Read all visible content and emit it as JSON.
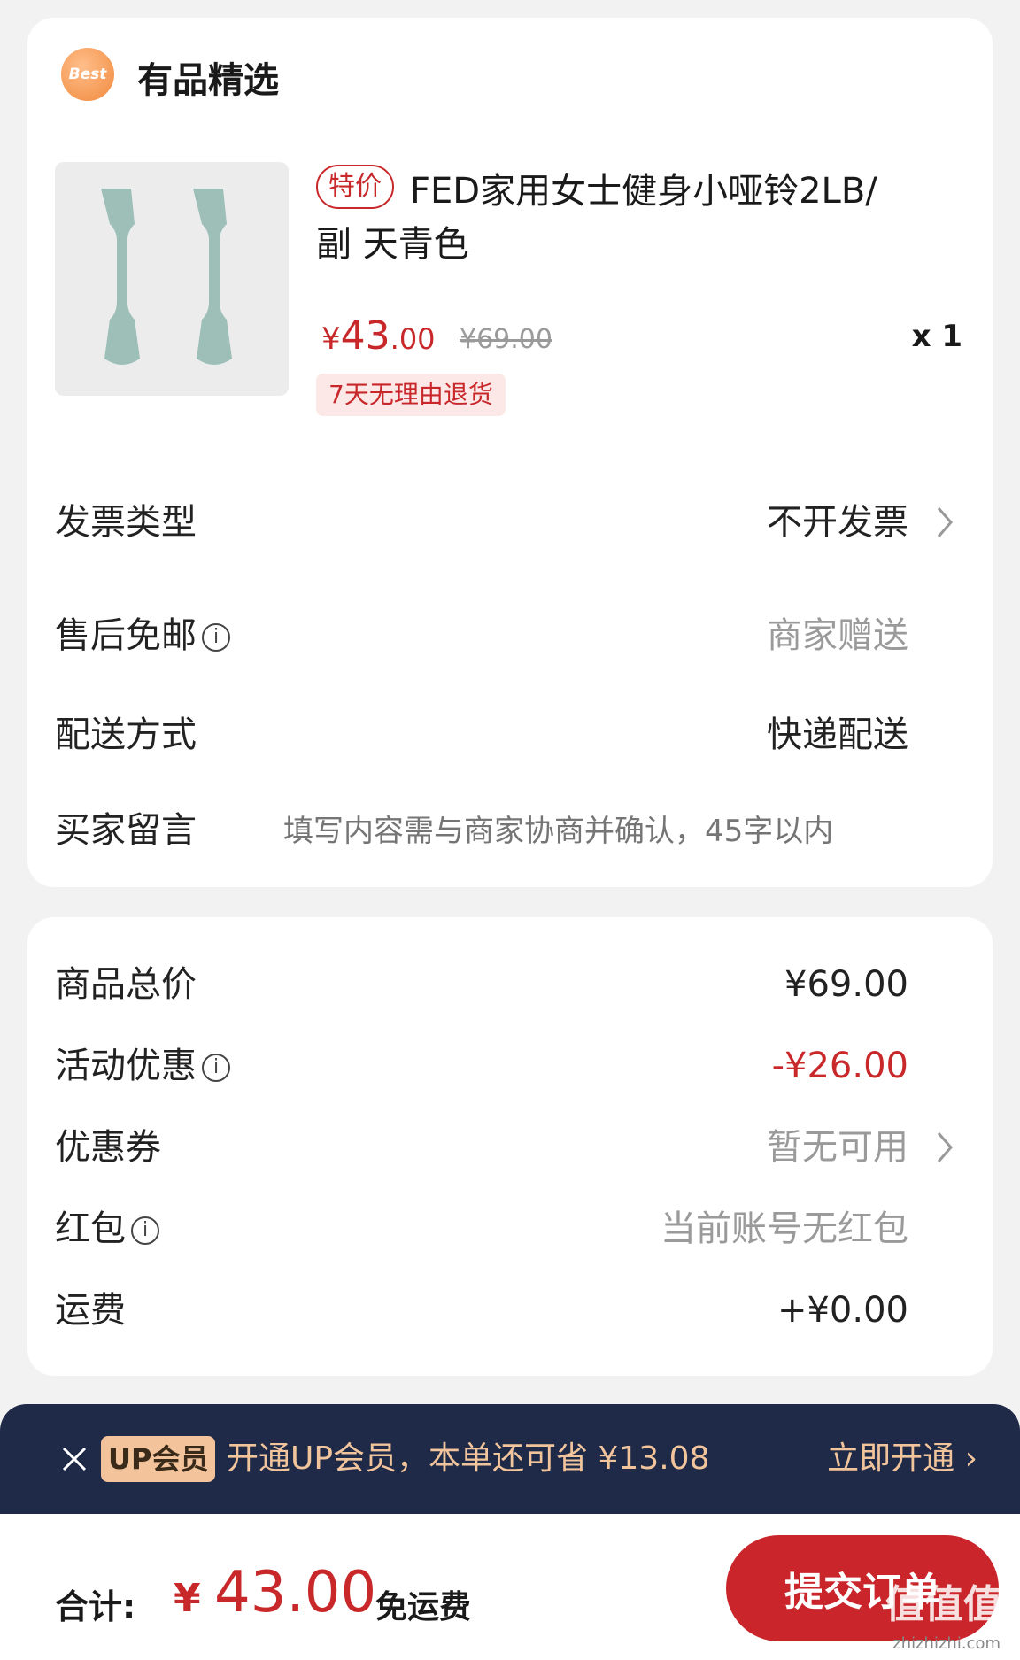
{
  "shop": {
    "badge_text": "Best",
    "title": "有品精选"
  },
  "product": {
    "tag": "特价",
    "name": "FED家用女士健身小哑铃2LB/副 天青色",
    "price_symbol": "¥",
    "price_int": "43",
    "price_dec": ".00",
    "original_price": "¥69.00",
    "quantity": "x 1",
    "return_policy": "7天无理由退货",
    "image_icon": "dumbbell-icon"
  },
  "order_rows": {
    "invoice": {
      "label": "发票类型",
      "value": "不开发票"
    },
    "return_shipping": {
      "label": "售后免邮",
      "info": "i",
      "value": "商家赠送"
    },
    "delivery": {
      "label": "配送方式",
      "value": "快递配送"
    },
    "message": {
      "label": "买家留言",
      "placeholder": "填写内容需与商家协商并确认，45字以内"
    }
  },
  "price_rows": {
    "subtotal": {
      "label": "商品总价",
      "value": "¥69.00"
    },
    "promotion": {
      "label": "活动优惠",
      "info": "i",
      "value": "-¥26.00"
    },
    "coupon": {
      "label": "优惠券",
      "value": "暂无可用"
    },
    "red_packet": {
      "label": "红包",
      "info": "i",
      "value": "当前账号无红包"
    },
    "shipping": {
      "label": "运费",
      "value": "+¥0.00"
    }
  },
  "up_banner": {
    "badge": "UP会员",
    "text": "开通UP会员，本单还可省 ¥13.08",
    "action": "立即开通 ›"
  },
  "footer": {
    "total_label": "合计:",
    "total_symbol": "¥",
    "total_amount": "43.00",
    "free_shipping": "免运费",
    "submit_label": "提交订单"
  },
  "watermark": {
    "brand": "值值值",
    "url": "zhizhizhi.com"
  },
  "colors": {
    "accent_red": "#c8282a",
    "banner_bg": "#1e2a47",
    "banner_text": "#f2c49c"
  }
}
